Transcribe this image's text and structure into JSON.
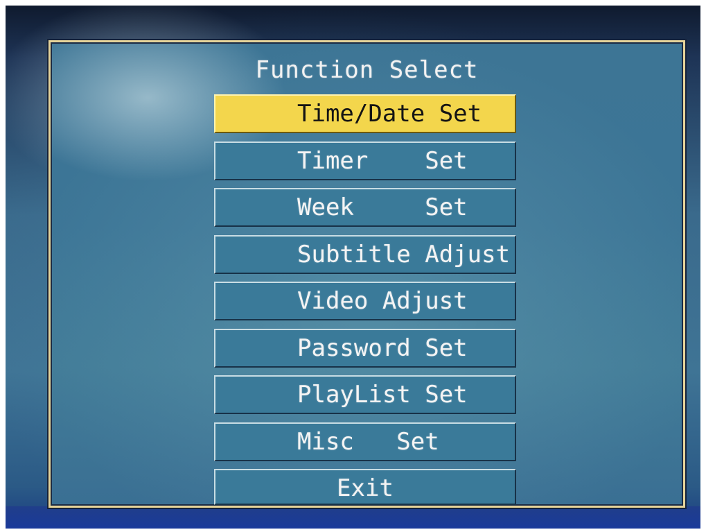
{
  "screen": {
    "title": "Function Select"
  },
  "menu": {
    "items": [
      {
        "label": "Time/Date Set",
        "selected": true
      },
      {
        "label": "Timer    Set",
        "selected": false
      },
      {
        "label": "Week     Set",
        "selected": false
      },
      {
        "label": "Subtitle Adjust",
        "selected": false
      },
      {
        "label": "Video Adjust",
        "selected": false
      },
      {
        "label": "Password Set",
        "selected": false
      },
      {
        "label": "PlayList Set",
        "selected": false
      },
      {
        "label": "Misc   Set",
        "selected": false
      },
      {
        "label": "Exit",
        "selected": false
      }
    ]
  },
  "colors": {
    "highlight": "#f3d64c",
    "item_background": "#3a7a99",
    "screen_border": "#e6d49a",
    "text": "#f4f4f4"
  }
}
